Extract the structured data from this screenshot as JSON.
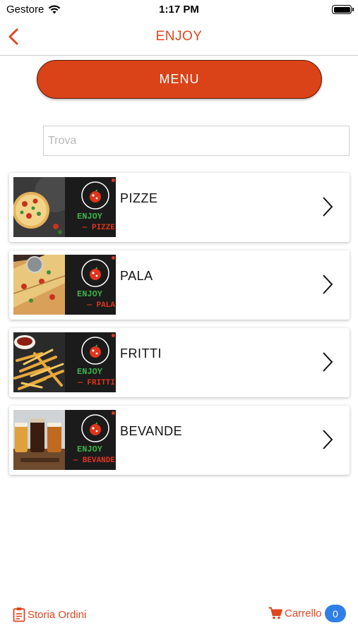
{
  "status_bar": {
    "carrier": "Gestore",
    "time": "1:17 PM",
    "icons": [
      "wifi-icon",
      "battery-icon"
    ]
  },
  "nav": {
    "title": "ENJOY",
    "back_icon": "chevron-left-icon"
  },
  "menu_button": {
    "label": "MENU"
  },
  "search": {
    "placeholder": "Trova",
    "value": ""
  },
  "categories": [
    {
      "label": "PIZZE",
      "thumb_brand": "ENJOY",
      "thumb_tag": "— PIZZE",
      "thumb_photo": "pizza-photo"
    },
    {
      "label": "PALA",
      "thumb_brand": "ENJOY",
      "thumb_tag": "— PALA",
      "thumb_photo": "pala-photo"
    },
    {
      "label": "FRITTI",
      "thumb_brand": "ENJOY",
      "thumb_tag": "— FRITTI",
      "thumb_photo": "fries-photo"
    },
    {
      "label": "BEVANDE",
      "thumb_brand": "ENJOY",
      "thumb_tag": "— BEVANDE",
      "thumb_photo": "beer-photo"
    }
  ],
  "bottom_bar": {
    "orders_label": "Storia Ordini",
    "orders_icon": "clipboard-icon",
    "cart_label": "Carrello",
    "cart_icon": "cart-icon",
    "cart_count": "0"
  },
  "colors": {
    "accent": "#e0461f",
    "menu_button": "#d94317",
    "badge": "#2f7fe6",
    "brand_green": "#3fb04a",
    "brand_red": "#e0351c"
  }
}
